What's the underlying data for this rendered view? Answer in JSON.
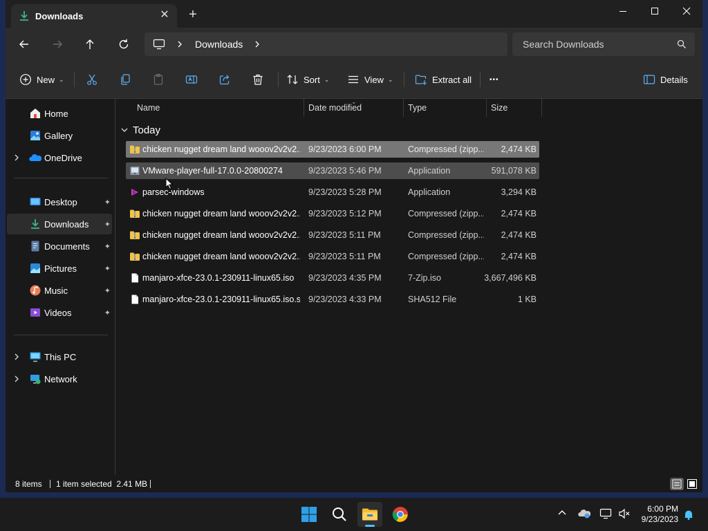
{
  "window": {
    "tab_title": "Downloads",
    "tab_close_glyph": "✕",
    "new_tab_glyph": "+"
  },
  "address": {
    "crumbs": [
      "Downloads"
    ],
    "search_placeholder": "Search Downloads"
  },
  "commands": {
    "new_label": "New",
    "sort_label": "Sort",
    "view_label": "View",
    "extract_label": "Extract all",
    "more_label": "•••",
    "details_label": "Details",
    "caret": "⌄"
  },
  "sidebar": {
    "items": [
      {
        "label": "Home",
        "icon": "home-icon"
      },
      {
        "label": "Gallery",
        "icon": "gallery-icon"
      },
      {
        "label": "OneDrive",
        "icon": "onedrive-icon"
      },
      {
        "label": "Desktop",
        "icon": "desktop-icon",
        "pinned": true
      },
      {
        "label": "Downloads",
        "icon": "downloads-icon",
        "pinned": true,
        "selected": true
      },
      {
        "label": "Documents",
        "icon": "documents-icon",
        "pinned": true
      },
      {
        "label": "Pictures",
        "icon": "pictures-icon",
        "pinned": true
      },
      {
        "label": "Music",
        "icon": "music-icon",
        "pinned": true
      },
      {
        "label": "Videos",
        "icon": "videos-icon",
        "pinned": true
      },
      {
        "label": "This PC",
        "icon": "this-pc-icon"
      },
      {
        "label": "Network",
        "icon": "network-icon"
      }
    ],
    "pin_glyph": "📌"
  },
  "list": {
    "columns": [
      "Name",
      "Date modified",
      "Type",
      "Size"
    ],
    "group_label": "Today",
    "files": [
      {
        "name": "chicken nugget dream land wooov2v2v2...",
        "date": "9/23/2023 6:00 PM",
        "type": "Compressed (zipp...",
        "size": "2,474 KB",
        "icon": "zip-folder-icon"
      },
      {
        "name": "VMware-player-full-17.0.0-20800274",
        "date": "9/23/2023 5:46 PM",
        "type": "Application",
        "size": "591,078 KB",
        "icon": "installer-icon"
      },
      {
        "name": "parsec-windows",
        "date": "9/23/2023 5:28 PM",
        "type": "Application",
        "size": "3,294 KB",
        "icon": "parsec-icon"
      },
      {
        "name": "chicken nugget dream land wooov2v2v2...",
        "date": "9/23/2023 5:12 PM",
        "type": "Compressed (zipp...",
        "size": "2,474 KB",
        "icon": "zip-folder-icon"
      },
      {
        "name": "chicken nugget dream land wooov2v2v2...",
        "date": "9/23/2023 5:11 PM",
        "type": "Compressed (zipp...",
        "size": "2,474 KB",
        "icon": "zip-folder-icon"
      },
      {
        "name": "chicken nugget dream land wooov2v2v2...",
        "date": "9/23/2023 5:11 PM",
        "type": "Compressed (zipp...",
        "size": "2,474 KB",
        "icon": "zip-folder-icon"
      },
      {
        "name": "manjaro-xfce-23.0.1-230911-linux65.iso",
        "date": "9/23/2023 4:35 PM",
        "type": "7-Zip.iso",
        "size": "3,667,496 KB",
        "icon": "file-icon"
      },
      {
        "name": "manjaro-xfce-23.0.1-230911-linux65.iso.s...",
        "date": "9/23/2023 4:33 PM",
        "type": "SHA512 File",
        "size": "1 KB",
        "icon": "file-icon"
      }
    ]
  },
  "status": {
    "count": "8 items",
    "selection": "1 item selected  2.41 MB"
  },
  "taskbar": {
    "time": "6:00 PM",
    "date": "9/23/2023"
  },
  "colors": {
    "accent": "#4cc2ff",
    "window_bg": "#191919",
    "chrome_bg": "#2c2c2c",
    "selected_row": "#777777"
  }
}
